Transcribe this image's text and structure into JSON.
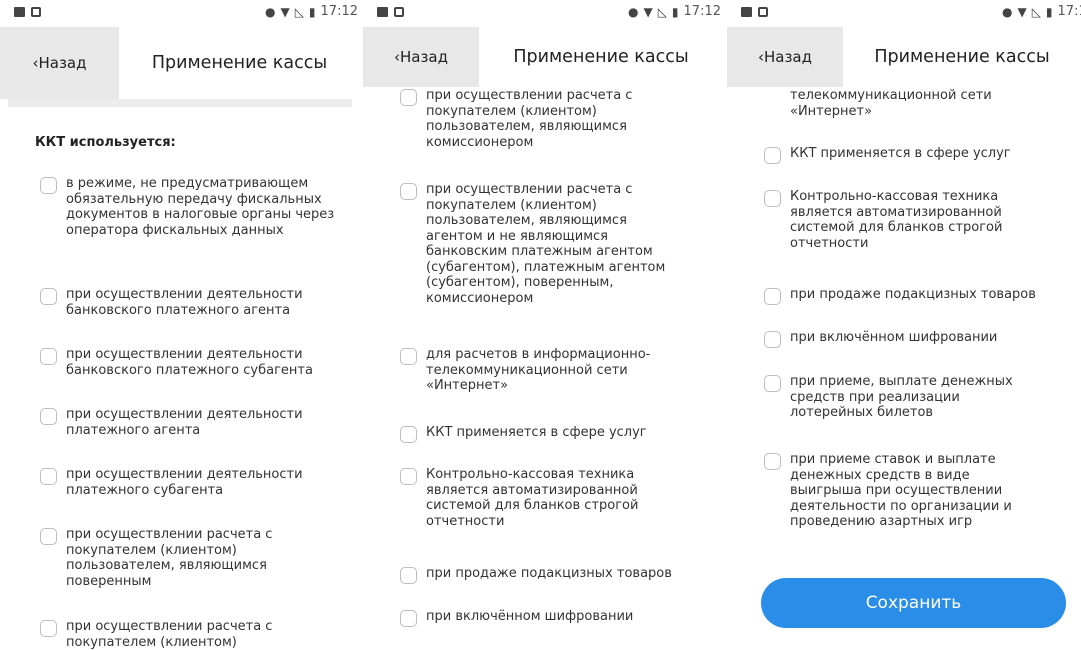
{
  "status_bar": {
    "time": "17:12",
    "icons": [
      "image-icon",
      "window-icon",
      "circle-icon",
      "wifi-icon",
      "no-signal-icon",
      "battery-icon"
    ]
  },
  "header": {
    "back_label": "‹Назад",
    "title": "Применение кассы"
  },
  "section": {
    "title": "ККТ используется:"
  },
  "options": [
    "в режиме, не предусматривающем обязательную передачу фискальных документов в налоговые органы через оператора фискальных данных",
    "при осуществлении деятельности банковского платежного агента",
    "при осуществлении деятельности банковского платежного субагента",
    "при осуществлении деятельности платежного агента",
    "при осуществлении деятельности платежного субагента",
    "при осуществлении расчета с покупателем (клиентом) пользователем, являющимся поверенным",
    "при осуществлении расчета с покупателем (клиентом) пользователем, являющимся комиссионером",
    "при осуществлении расчета с покупателем (клиентом) пользователем, являющимся агентом и не являющимся банковским платежным агентом (субагентом), платежным агентом (субагентом), поверенным, комиссионером",
    "для расчетов в информационно-телекоммуникационной сети «Интернет»",
    "ККТ применяется в сфере услуг",
    "Контрольно-кассовая техника является автоматизированной системой для бланков строгой отчетности",
    "при продаже подакцизных товаров",
    "при включённом шифровании",
    "при приеме, выплате денежных средств при реализации лотерейных билетов",
    "при приеме ставок и выплате денежных средств в виде выигрыша при осуществлении деятельности по организации и проведению азартных игр"
  ],
  "panel1_partial_option": "при осуществлении расчета с покупателем (клиентом)",
  "panel3_partial_option": "телекоммуникационной сети «Интернет»",
  "save_label": "Сохранить",
  "colors": {
    "accent": "#2a8ee8",
    "back_bg": "#e8e8e8",
    "checkbox_border": "#bdbdbd"
  }
}
